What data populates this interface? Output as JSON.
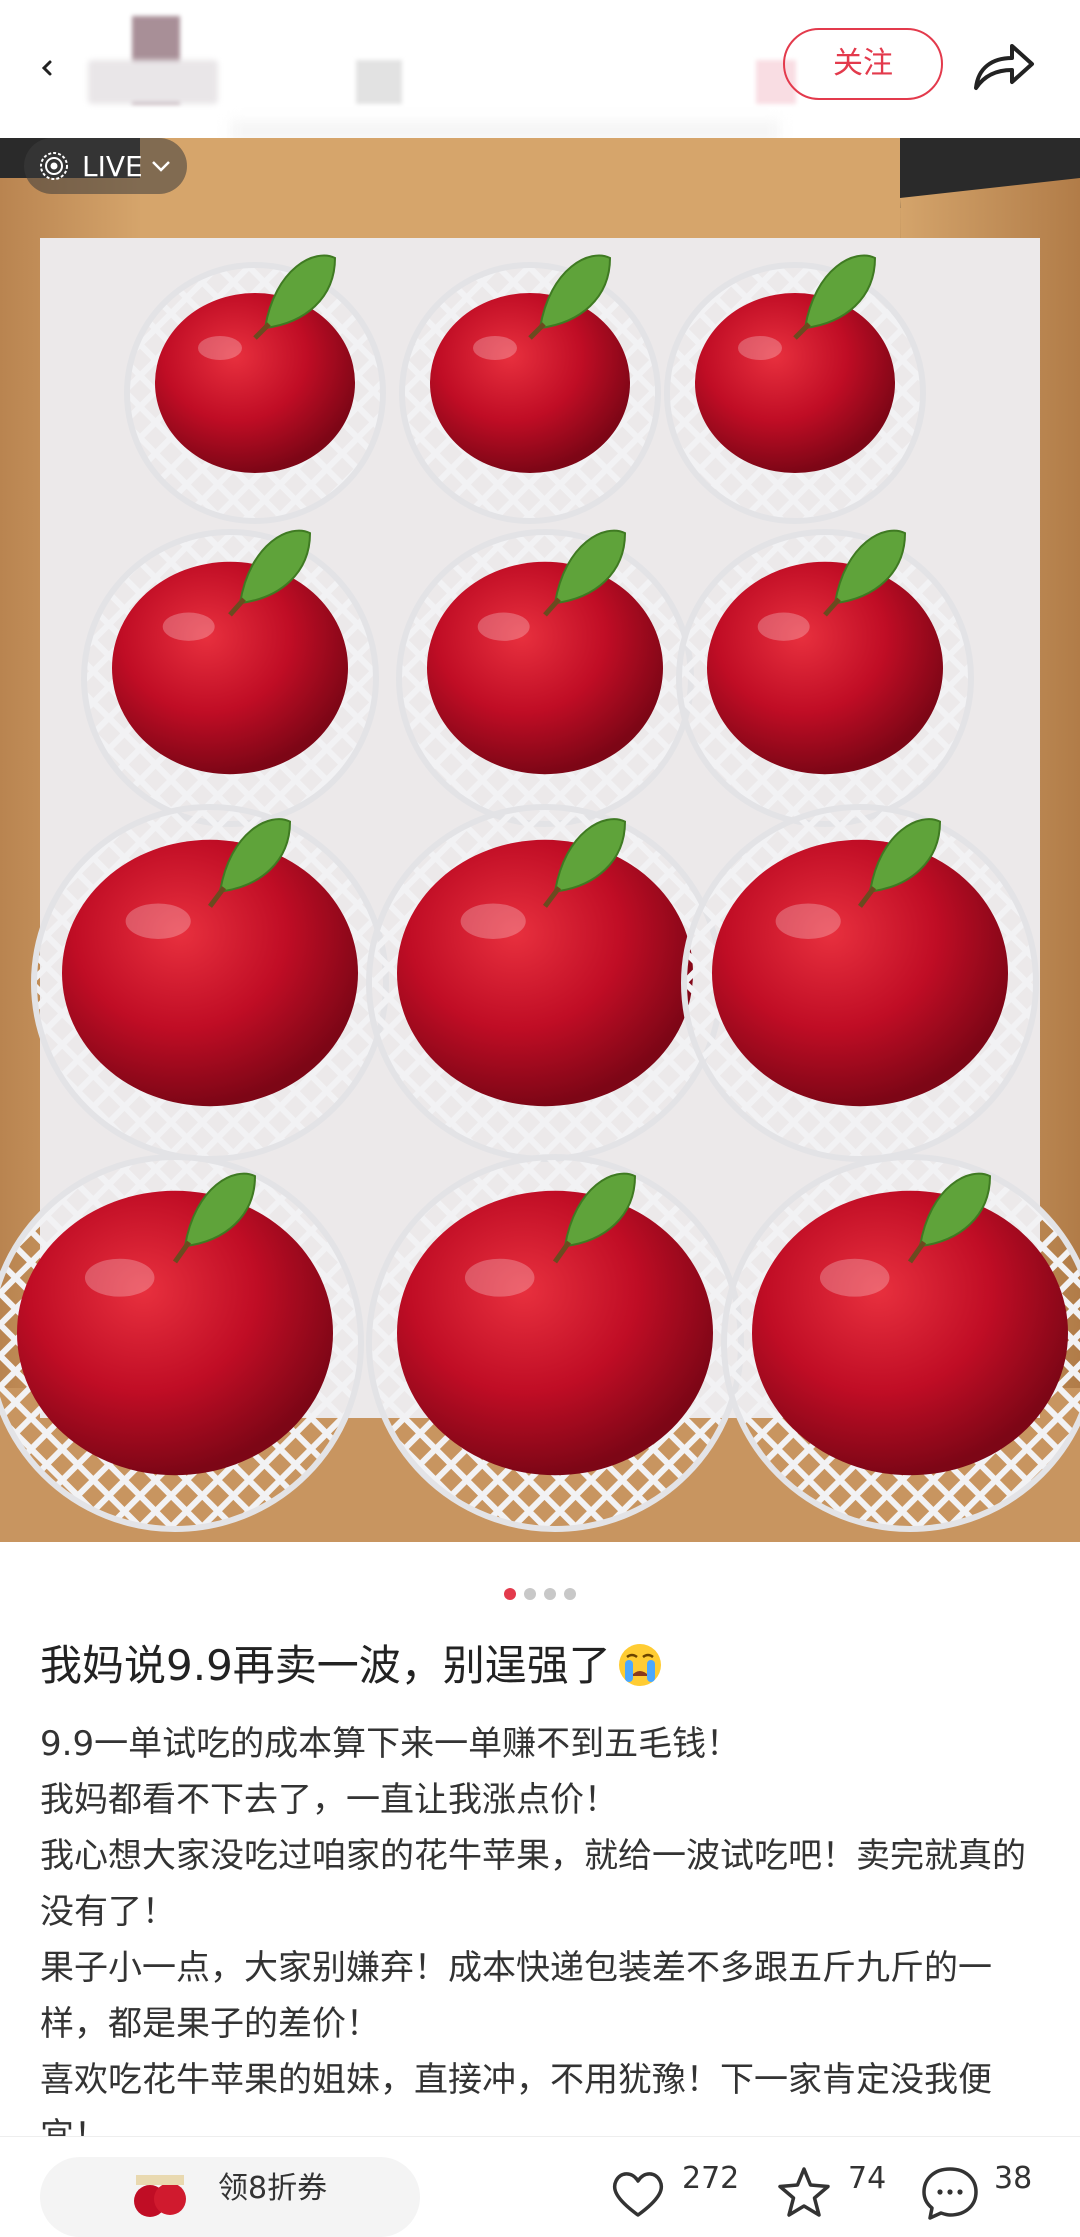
{
  "header": {
    "follow_label": "关注",
    "back_icon": "chevron-left-icon",
    "share_icon": "share-arrow-icon"
  },
  "media": {
    "live_label": "LIVE",
    "pager": {
      "count": 4,
      "active": 1
    }
  },
  "post": {
    "title": "我妈说9.9再卖一波，别逞强了",
    "title_emoji": "loudly-crying-face",
    "body": [
      "9.9一单试吃的成本算下来一单赚不到五毛钱！",
      "我妈都看不下去了，一直让我涨点价！",
      "我心想大家没吃过咱家的花牛苹果，就给一波试吃吧！卖完就真的没有了！",
      "果子小一点，大家别嫌弃！成本快递包装差不多跟五斤九斤的一样，都是果子的差价！",
      "喜欢吃花牛苹果的姐妹，直接冲，不用犹豫！下一家肯定没我便宜！"
    ]
  },
  "bottom": {
    "coupon_label": "领8折券",
    "likes": "272",
    "collects": "74",
    "comments": "38"
  },
  "colors": {
    "accent": "#e33a4c",
    "box": "#c99a63",
    "apple": "#c8102e"
  }
}
